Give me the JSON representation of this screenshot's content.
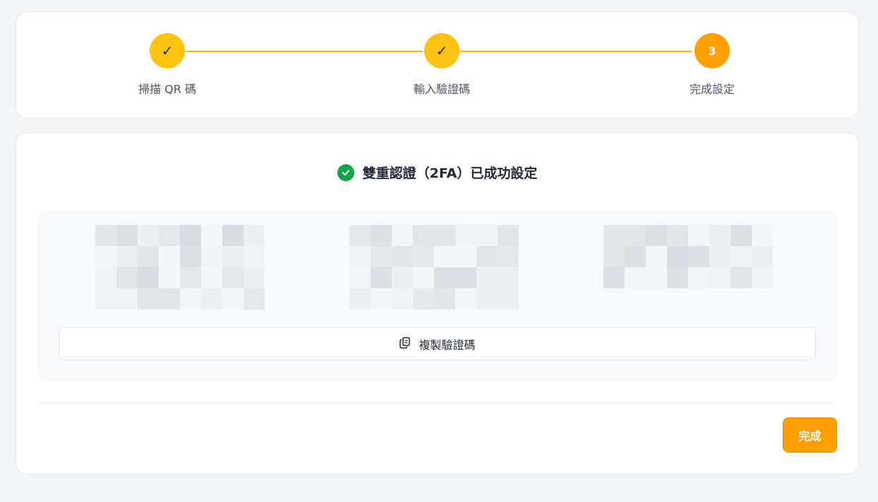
{
  "stepper": {
    "steps": [
      {
        "label": "掃描 QR 碼",
        "state": "done",
        "mark": "✓"
      },
      {
        "label": "輸入驗證碼",
        "state": "done",
        "mark": "✓"
      },
      {
        "label": "完成設定",
        "state": "current",
        "mark": "3"
      }
    ]
  },
  "main": {
    "title": "雙重認證（2FA）已成功設定",
    "copy_label": "複製驗證碼",
    "done_label": "完成"
  },
  "colors": {
    "accent": "#ffc20e",
    "current": "#ff9f00",
    "success": "#16a34a"
  }
}
